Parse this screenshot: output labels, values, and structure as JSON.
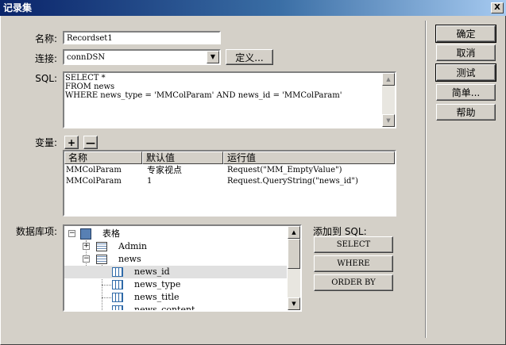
{
  "window": {
    "title": "记录集",
    "close_label": "X"
  },
  "form": {
    "name_label": "名称:",
    "name_value": "Recordset1",
    "connection_label": "连接:",
    "connection_value": "connDSN",
    "define_label": "定义...",
    "sql_label": "SQL:",
    "sql_text": "SELECT *\nFROM news\nWHERE news_type = 'MMColParam' AND news_id = 'MMColParam'",
    "variables_label": "变量:",
    "add_variable": "+",
    "remove_variable": "—",
    "database_items_label": "数据库项:",
    "add_to_sql_label": "添加到 SQL:"
  },
  "variables_table": {
    "headers": [
      "名称",
      "默认值",
      "运行值"
    ],
    "rows": [
      {
        "name": "MMColParam",
        "default": "专家视点",
        "runtime": "Request(\"MM_EmptyValue\")"
      },
      {
        "name": "MMColParam",
        "default": "1",
        "runtime": "Request.QueryString(\"news_id\")"
      }
    ]
  },
  "tree": {
    "root": "表格",
    "items": [
      {
        "label": "Admin",
        "expander": "+"
      },
      {
        "label": "news",
        "expander": "−"
      },
      {
        "label": "news_id"
      },
      {
        "label": "news_type"
      },
      {
        "label": "news_title"
      },
      {
        "label": "news_content"
      }
    ]
  },
  "sql_buttons": {
    "select": "SELECT",
    "where": "WHERE",
    "order_by": "ORDER BY"
  },
  "side_buttons": {
    "ok": "确定",
    "cancel": "取消",
    "test": "测试",
    "simple": "简单...",
    "help": "帮助"
  }
}
